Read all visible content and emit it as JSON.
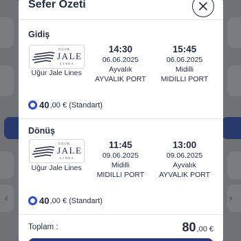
{
  "modal": {
    "title": "Sefer Özeti",
    "close_icon": "close-icon"
  },
  "outbound": {
    "label": "Gidiş",
    "logo": {
      "top": "UĞUR",
      "main": "JALE",
      "bottom": "LINES"
    },
    "company": "Uğur Jale Lines",
    "departure": {
      "time": "14:30",
      "date": "06.06.2025",
      "city": "Ayvalık",
      "port": "AYVALIK PORT"
    },
    "arrival": {
      "time": "15:45",
      "date": "06.06.2025",
      "city": "Midilli",
      "port": "MIDILLI PORT"
    },
    "price": {
      "amount": "40",
      "suffix": ",00 € (Standart)"
    }
  },
  "return": {
    "label": "Dönüş",
    "logo": {
      "top": "UĞUR",
      "main": "JALE",
      "bottom": "LINES"
    },
    "company": "Uğur Jale Lines",
    "departure": {
      "time": "11:45",
      "date": "09.06.2025",
      "city": "Midilli",
      "port": "MIDILLI PORT"
    },
    "arrival": {
      "time": "13:00",
      "date": "09.06.2025",
      "city": "Ayvalık",
      "port": "AYVALIK PORT"
    },
    "price": {
      "amount": "40",
      "suffix": ",00 € (Standart)"
    }
  },
  "total": {
    "label": "Toplam :",
    "int": "80",
    "dec": ",00 €"
  },
  "colors": {
    "accent": "#2a4bd6",
    "navy": "#1f2a44",
    "button": "#263a78"
  }
}
